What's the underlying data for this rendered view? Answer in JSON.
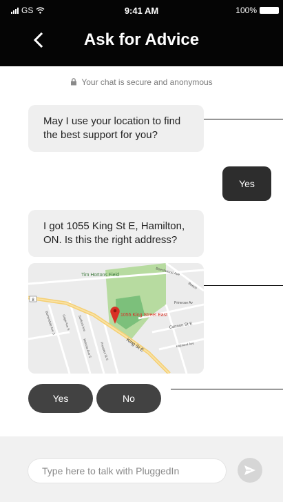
{
  "status_bar": {
    "carrier": "GS",
    "time": "9:41 AM",
    "battery": "100%"
  },
  "header": {
    "title": "Ask for Advice"
  },
  "chat": {
    "secure_notice": "Your chat is secure and anonymous",
    "messages": [
      {
        "from": "bot",
        "text": "May I use your location to find the best support for you?"
      },
      {
        "from": "user",
        "text": "Yes"
      },
      {
        "from": "bot",
        "text": "I got 1055 King St E, Hamilton, ON. Is this the right address?"
      }
    ],
    "map": {
      "pin_label": "1055 King Street East",
      "labels": {
        "park": "Tim Hortons Field",
        "main_street": "King St E",
        "cannon": "Cannon St E",
        "primrose": "Primrose Av",
        "beechwood": "Beechwood Ave",
        "beech": "Beech",
        "highland": "Highland Ave",
        "barnesdale": "Barnesdale Ave S",
        "gage": "Gage Ave S",
        "sanford": "Sanford Ave",
        "melrose": "Melrose Ave S",
        "prospect": "Prospect St S",
        "route": "8"
      }
    },
    "quick_replies": [
      {
        "label": "Yes"
      },
      {
        "label": "No"
      }
    ]
  },
  "composer": {
    "placeholder": "Type here to talk with PluggedIn",
    "value": ""
  },
  "colors": {
    "header_bg": "#050505",
    "bubble_bot": "#efefef",
    "bubble_user": "#2d2d2d",
    "quick_reply": "#424242",
    "composer_bg": "#f1f1f1",
    "map_pin": "#d93025",
    "park_green": "#b7dba0"
  },
  "icons": {
    "back": "chevron-left-icon",
    "lock": "lock-icon",
    "send": "send-arrow-icon",
    "signal": "signal-bars-icon",
    "wifi": "wifi-icon",
    "battery": "battery-icon",
    "pin": "map-pin-icon"
  }
}
